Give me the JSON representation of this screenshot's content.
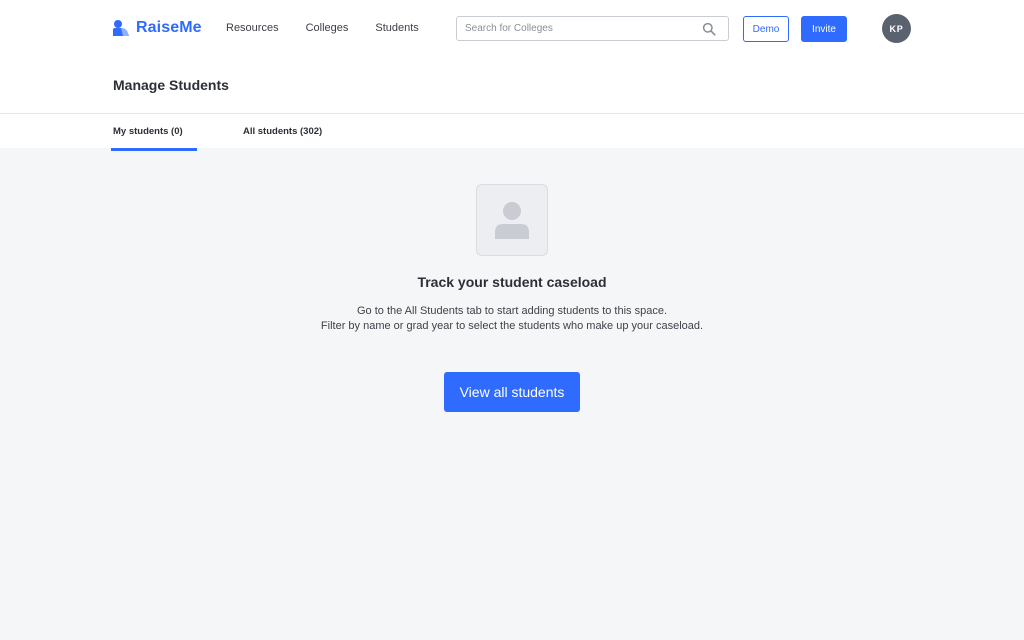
{
  "header": {
    "brand": "RaiseMe",
    "nav": [
      {
        "label": "Resources"
      },
      {
        "label": "Colleges"
      },
      {
        "label": "Students"
      }
    ],
    "search": {
      "placeholder": "Search for Colleges",
      "value": ""
    },
    "demo_label": "Demo",
    "invite_label": "Invite",
    "avatar_initials": "KP"
  },
  "page": {
    "title": "Manage Students"
  },
  "tabs": [
    {
      "label": "My students (0)",
      "active": true
    },
    {
      "label": "All students (302)",
      "active": false
    }
  ],
  "empty_state": {
    "icon": "user-placeholder-icon",
    "title": "Track your student caseload",
    "line1": "Go to the All Students tab to start adding students to this space.",
    "line2": "Filter by name or grad year to select the students who make up your caseload.",
    "button_label": "View all students"
  },
  "colors": {
    "accent": "#2f6bff",
    "background": "#f5f6f8",
    "avatar": "#5a6270"
  }
}
